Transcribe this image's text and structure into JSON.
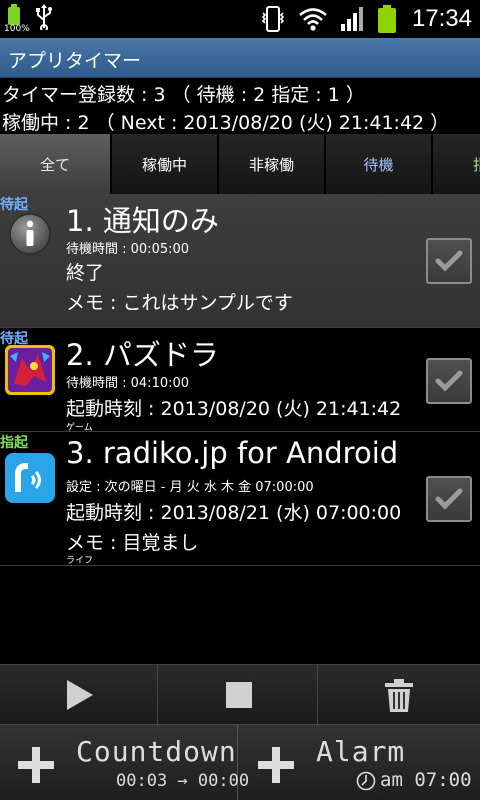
{
  "status_bar": {
    "battery_percent_label": "100%",
    "time": "17:34",
    "icons": [
      "battery-small-icon",
      "usb-icon",
      "vibrate-icon",
      "wifi-icon",
      "signal-icon",
      "battery-icon"
    ],
    "battery_color": "#8fd400"
  },
  "app": {
    "title": "アプリタイマー"
  },
  "summary": {
    "line1": "タイマー登録数 : 3 （ 待機 : 2  指定 : 1 ）",
    "line2": "稼働中 : 2  （ Next : 2013/08/20 (火) 21:41:42 ）"
  },
  "tabs": [
    {
      "label": "全て",
      "active": true
    },
    {
      "label": "稼働中",
      "active": false
    },
    {
      "label": "非稼働",
      "active": false
    },
    {
      "label": "待機",
      "active": false
    },
    {
      "label": "指",
      "active": false
    }
  ],
  "timers": [
    {
      "badge": "待起",
      "title": "1. 通知のみ",
      "detail": "待機時間 : 00:05:00",
      "action": "終了",
      "memo": "メモ : これはサンプルです",
      "icon": "info-icon",
      "checked": true
    },
    {
      "badge": "待起",
      "title": "2. パズドラ",
      "detail": "待機時間 : 04:10:00",
      "launch": "起動時刻 :  2013/08/20 (火) 21:41:42",
      "category": "ゲーム",
      "icon": "puzzle-dragons-app-icon",
      "checked": true
    },
    {
      "badge": "指起",
      "title": "3. radiko.jp for Android",
      "detail": "設定 : 次の曜日 - 月 火 水 木 金   07:00:00",
      "launch": "起動時刻 : 2013/08/21 (水) 07:00:00",
      "memo": "メモ : 目覚まし",
      "category": "ライフ",
      "icon": "radiko-app-icon",
      "checked": true
    }
  ],
  "controls": {
    "icons": [
      "play-icon",
      "stop-icon",
      "trash-icon"
    ]
  },
  "add_buttons": {
    "countdown_label": "Countdown",
    "countdown_sub": "00:03 → 00:00",
    "alarm_label": "Alarm",
    "alarm_sub": "am 07:00"
  }
}
